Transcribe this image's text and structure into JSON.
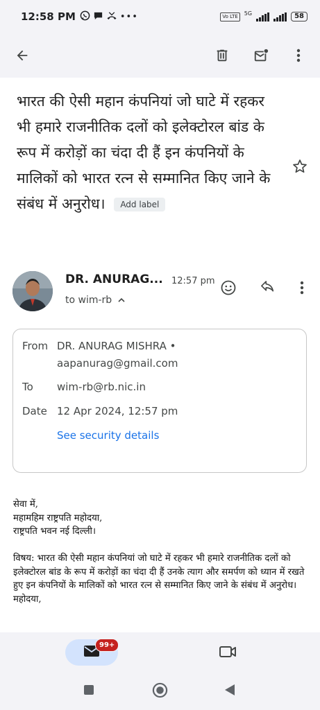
{
  "status_bar": {
    "time": "12:58 PM",
    "network": "5G",
    "volte": "Vo LTE",
    "battery": "58",
    "left_icons": [
      "whatsapp-icon",
      "chat-icon",
      "missed-call-icon",
      "more-dots-icon"
    ]
  },
  "app_bar": {
    "icons": [
      "back-arrow-icon",
      "delete-icon",
      "mark-unread-icon",
      "more-vert-icon"
    ]
  },
  "email": {
    "subject": "भारत की ऐसी महान कंपनियां जो घाटे में रहकर भी हमारे राजनीतिक दलों को इलेक्टोरल बांड के रूप में करोड़ों का चंदा दी हैं इन कंपनियों के मालिकों को भारत रत्न से सम्मानित किए जाने के संबंध में अनुरोध।",
    "add_label": "Add label",
    "sender_short": "DR. ANURAG...",
    "time": "12:57 pm",
    "to_line": "to wim-rb"
  },
  "details": {
    "from_label": "From",
    "from_value": "DR. ANURAG MISHRA • aapanurag@gmail.com",
    "to_label": "To",
    "to_value": "wim-rb@rb.nic.in",
    "date_label": "Date",
    "date_value": "12 Apr 2024, 12:57 pm",
    "security_link": "See security details"
  },
  "body": {
    "line1": "सेवा में,",
    "line2": "महामहिम राष्ट्रपति महोदया,",
    "line3": "राष्ट्रपति भवन नई दिल्ली।",
    "vishay": "विषय: भारत की ऐसी महान कंपनियां जो घाटे में रहकर भी हमारे राजनीतिक दलों को इलेक्टोरल बांड के रूप में करोड़ों का चंदा दी हैं उनके त्याग और समर्पण को ध्यान में रखते हुए इन कंपनियों के मालिकों को भारत रत्न से सम्मानित किए जाने के संबंध में अनुरोध।",
    "salutation": "महोदया,"
  },
  "bottom_nav": {
    "mail_badge": "99+"
  },
  "colors": {
    "bar_background": "#f3f3f7",
    "link_blue": "#1a73e8",
    "badge_red": "#c5221f",
    "pill_blue": "#d3e3fd"
  }
}
